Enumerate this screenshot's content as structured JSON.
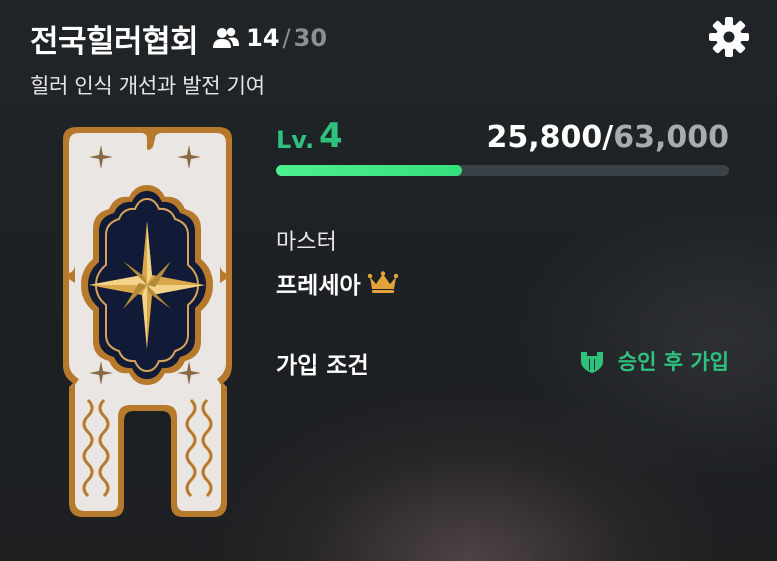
{
  "guild": {
    "name": "전국힐러협회",
    "members_current": "14",
    "members_separator": "/",
    "members_max": "30",
    "description": "힐러 인식 개선과 발전 기여"
  },
  "level": {
    "label": "Lv.",
    "value": "4",
    "exp_current": "25,800",
    "exp_separator": "/",
    "exp_max": "63,000",
    "progress_fraction": 0.41
  },
  "master": {
    "label": "마스터",
    "name": "프레세아"
  },
  "join": {
    "label": "가입 조건",
    "condition": "승인 후 가입"
  },
  "icons": {
    "members": "people-icon",
    "settings": "gear-icon",
    "master": "crown-icon",
    "join": "approval-shield-icon",
    "banner": "guild-emblem-banner"
  },
  "colors": {
    "accent_green": "#2ec27e",
    "bar_fill": "#4ef08c",
    "crown_gold": "#e2a43a",
    "banner_gold": "#b77a2c",
    "banner_navy": "#0b1433"
  }
}
